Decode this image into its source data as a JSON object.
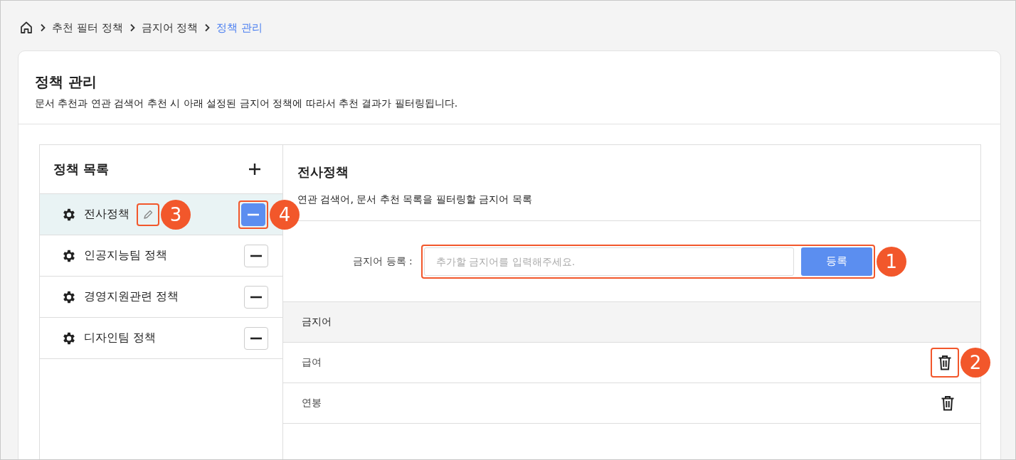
{
  "breadcrumb": [
    {
      "label": "추천 필터 정책",
      "current": false
    },
    {
      "label": "금지어 정책",
      "current": false
    },
    {
      "label": "정책 관리",
      "current": true
    }
  ],
  "page": {
    "title": "정책 관리",
    "description": "문서 추천과 연관 검색어 추천 시 아래 설정된 금지어 정책에 따라서 추천 결과가 필터링됩니다."
  },
  "policy_list": {
    "title": "정책 목록",
    "items": [
      {
        "name": "전사정책",
        "selected": true,
        "edit_callout": "3",
        "remove_callout": "4"
      },
      {
        "name": "인공지능팀 정책",
        "selected": false
      },
      {
        "name": "경영지원관련 정책",
        "selected": false
      },
      {
        "name": "디자인팀 정책",
        "selected": false
      }
    ]
  },
  "detail": {
    "title": "전사정책",
    "description": "연관 검색어, 문서 추천 목록을 필터링할 금지어 목록",
    "register": {
      "label": "금지어 등록 :",
      "placeholder": "추가할 금지어를 입력해주세요.",
      "button": "등록",
      "callout": "1"
    },
    "table": {
      "columns": [
        "금지어"
      ],
      "rows": [
        {
          "word": "급여",
          "delete_callout": "2"
        },
        {
          "word": "연봉"
        }
      ]
    }
  }
}
